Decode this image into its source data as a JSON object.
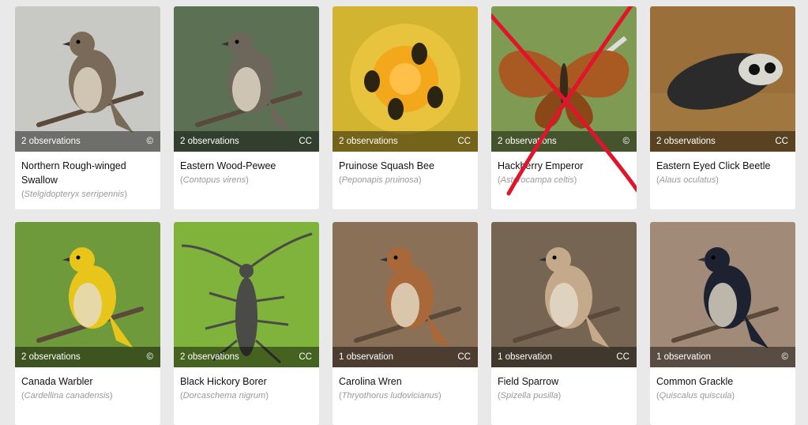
{
  "cards": [
    {
      "count": "2 observations",
      "license": "©",
      "common": "Northern Rough-winged Swallow",
      "scientific": "Stelgidopteryx serripennis",
      "bg": "#c8c9c5",
      "subject": "bird",
      "color": "#7a6a58"
    },
    {
      "count": "2 observations",
      "license": "CC",
      "common": "Eastern Wood-Pewee",
      "scientific": "Contopus virens",
      "bg": "#5c7154",
      "subject": "bird",
      "color": "#6d675b"
    },
    {
      "count": "2 observations",
      "license": "CC",
      "common": "Pruinose Squash Bee",
      "scientific": "Peponapis pruinosa",
      "bg": "#d3b431",
      "subject": "flower",
      "color": "#f2a81a"
    },
    {
      "count": "2 observations",
      "license": "©",
      "common": "Hackberry Emperor",
      "scientific": "Asterocampa celtis",
      "bg": "#7f9a52",
      "subject": "butterfly",
      "color": "#a85a22",
      "crossed": true
    },
    {
      "count": "2 observations",
      "license": "CC",
      "common": "Eastern Eyed Click Beetle",
      "scientific": "Alaus oculatus",
      "bg": "#9a6f3a",
      "subject": "beetle",
      "color": "#2b2b2b"
    },
    {
      "count": "2 observations",
      "license": "©",
      "common": "Canada Warbler",
      "scientific": "Cardellina canadensis",
      "bg": "#6f9a3c",
      "subject": "bird",
      "color": "#e8c51a"
    },
    {
      "count": "2 observations",
      "license": "CC",
      "common": "Black Hickory Borer",
      "scientific": "Dorcaschema nigrum",
      "bg": "#7fb33c",
      "subject": "longhorn",
      "color": "#4a4a46"
    },
    {
      "count": "1 observation",
      "license": "CC",
      "common": "Carolina Wren",
      "scientific": "Thryothorus ludovicianus",
      "bg": "#8b7058",
      "subject": "bird",
      "color": "#a8683a"
    },
    {
      "count": "1 observation",
      "license": "CC",
      "common": "Field Sparrow",
      "scientific": "Spizella pusilla",
      "bg": "#766552",
      "subject": "bird",
      "color": "#c4a98a"
    },
    {
      "count": "1 observation",
      "license": "©",
      "common": "Common Grackle",
      "scientific": "Quiscalus quiscula",
      "bg": "#a28a78",
      "subject": "bird",
      "color": "#1d2230"
    }
  ]
}
